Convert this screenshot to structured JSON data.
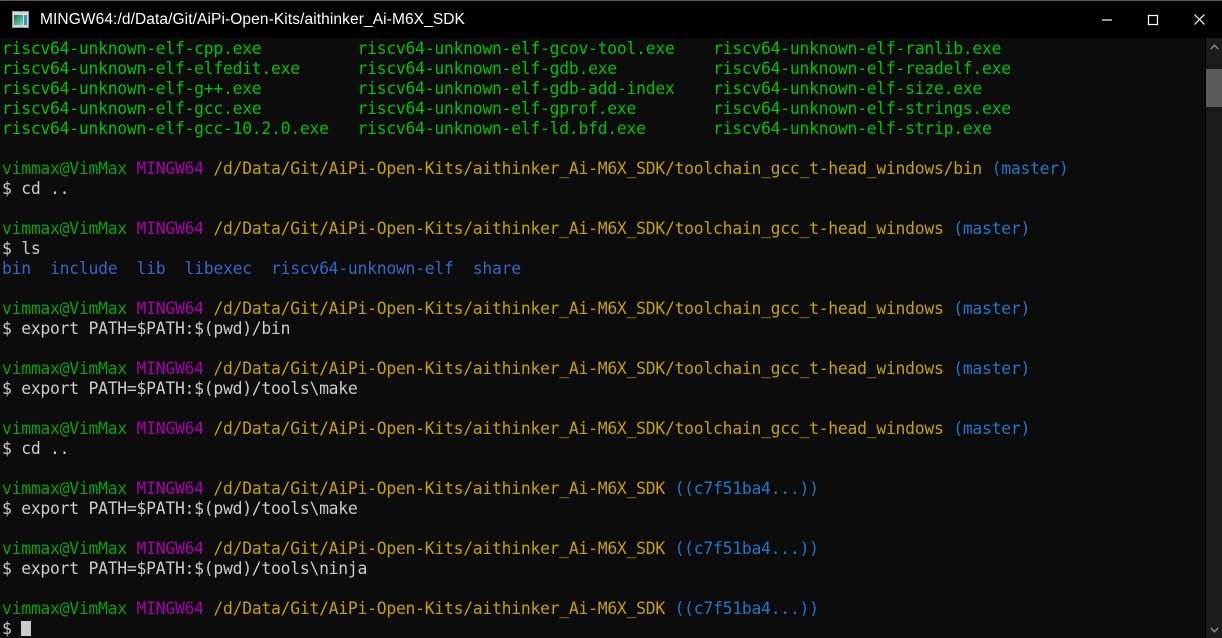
{
  "window": {
    "title": "MINGW64:/d/Data/Git/AiPi-Open-Kits/aithinker_Ai-M6X_SDK",
    "icon": "mintty-terminal-icon",
    "controls": {
      "minimize_label": "—",
      "maximize_label": "□",
      "close_label": "✕"
    }
  },
  "colors": {
    "background": "#0c0c0c",
    "foreground": "#cccccc",
    "green_exe": "#00c200",
    "green_prompt": "#0ca00c",
    "magenta": "#a600a6",
    "yellow_path": "#c5a100",
    "cyan_branch": "#2176c7",
    "blue_dir": "#3465c8",
    "titlebar": "#000000",
    "scrollbar_track": "#1b1b1b",
    "scrollbar_thumb": "#5a5a5a"
  },
  "terminal": {
    "prompt_user_host": "vimmax@VimMax",
    "prompt_shell": "MINGW64",
    "prompt_symbol": "$",
    "exe_listing": [
      [
        "riscv64-unknown-elf-cpp.exe",
        "riscv64-unknown-elf-gcov-tool.exe",
        "riscv64-unknown-elf-ranlib.exe"
      ],
      [
        "riscv64-unknown-elf-elfedit.exe",
        "riscv64-unknown-elf-gdb.exe",
        "riscv64-unknown-elf-readelf.exe"
      ],
      [
        "riscv64-unknown-elf-g++.exe",
        "riscv64-unknown-elf-gdb-add-index",
        "riscv64-unknown-elf-size.exe"
      ],
      [
        "riscv64-unknown-elf-gcc.exe",
        "riscv64-unknown-elf-gprof.exe",
        "riscv64-unknown-elf-strings.exe"
      ],
      [
        "riscv64-unknown-elf-gcc-10.2.0.exe",
        "riscv64-unknown-elf-ld.bfd.exe",
        "riscv64-unknown-elf-strip.exe"
      ]
    ],
    "blocks": [
      {
        "path": "/d/Data/Git/AiPi-Open-Kits/aithinker_Ai-M6X_SDK/toolchain_gcc_t-head_windows/bin",
        "branch": "(master)",
        "command": "cd ..",
        "output": null
      },
      {
        "path": "/d/Data/Git/AiPi-Open-Kits/aithinker_Ai-M6X_SDK/toolchain_gcc_t-head_windows",
        "branch": "(master)",
        "command": "ls",
        "output": "bin  include  lib  libexec  riscv64-unknown-elf  share"
      },
      {
        "path": "/d/Data/Git/AiPi-Open-Kits/aithinker_Ai-M6X_SDK/toolchain_gcc_t-head_windows",
        "branch": "(master)",
        "command": "export PATH=$PATH:$(pwd)/bin",
        "output": null
      },
      {
        "path": "/d/Data/Git/AiPi-Open-Kits/aithinker_Ai-M6X_SDK/toolchain_gcc_t-head_windows",
        "branch": "(master)",
        "command": "export PATH=$PATH:$(pwd)/tools\\make",
        "output": null
      },
      {
        "path": "/d/Data/Git/AiPi-Open-Kits/aithinker_Ai-M6X_SDK/toolchain_gcc_t-head_windows",
        "branch": "(master)",
        "command": "cd ..",
        "output": null
      },
      {
        "path": "/d/Data/Git/AiPi-Open-Kits/aithinker_Ai-M6X_SDK",
        "branch": "((c7f51ba4...))",
        "command": "export PATH=$PATH:$(pwd)/tools\\make",
        "output": null
      },
      {
        "path": "/d/Data/Git/AiPi-Open-Kits/aithinker_Ai-M6X_SDK",
        "branch": "((c7f51ba4...))",
        "command": "export PATH=$PATH:$(pwd)/tools\\ninja",
        "output": null
      },
      {
        "path": "/d/Data/Git/AiPi-Open-Kits/aithinker_Ai-M6X_SDK",
        "branch": "((c7f51ba4...))",
        "command": "",
        "output": null
      }
    ],
    "ls_dirs": [
      "bin",
      "include",
      "lib",
      "libexec",
      "riscv64-unknown-elf",
      "share"
    ]
  },
  "scrollbar": {
    "up_arrow": "⌃",
    "down_arrow": "⌄"
  }
}
